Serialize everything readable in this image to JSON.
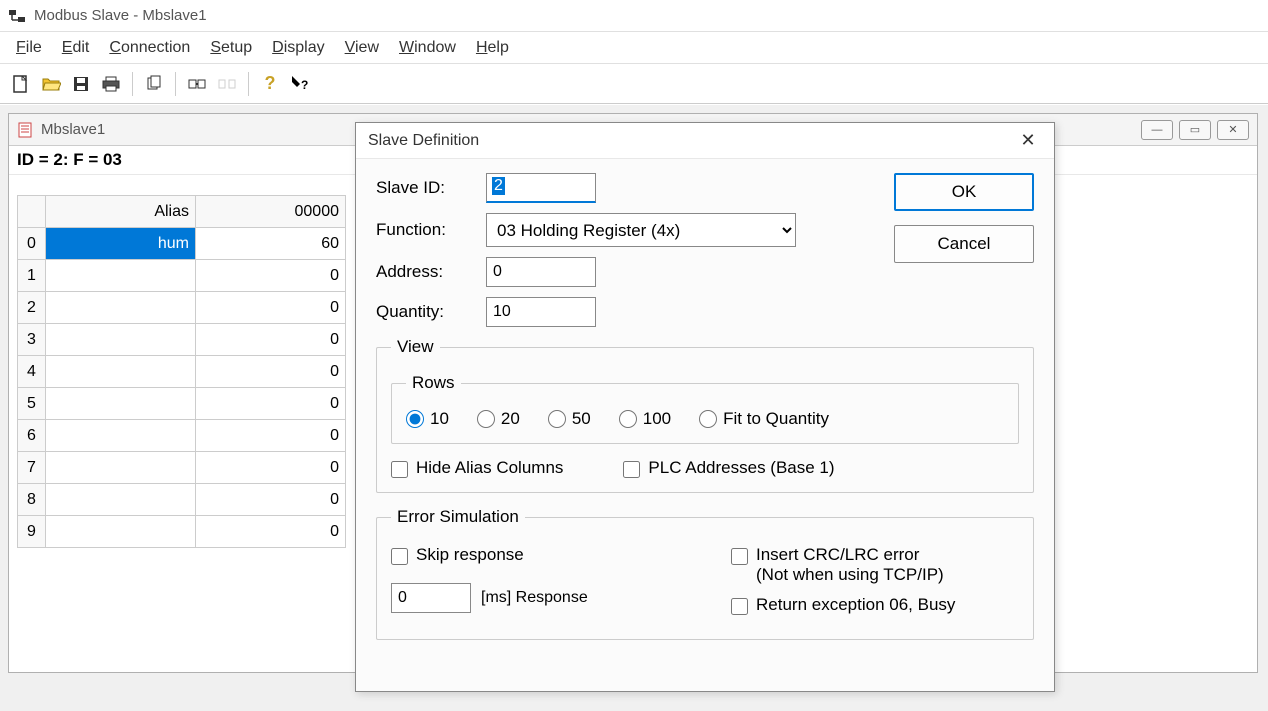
{
  "app": {
    "title": "Modbus Slave - Mbslave1"
  },
  "menu": {
    "file": "File",
    "edit": "Edit",
    "connection": "Connection",
    "setup": "Setup",
    "display": "Display",
    "view": "View",
    "window": "Window",
    "help": "Help"
  },
  "mdi": {
    "title": "Mbslave1",
    "status": "ID = 2: F = 03",
    "headers": {
      "alias": "Alias",
      "val": "00000"
    },
    "rows": [
      {
        "n": "0",
        "alias": "hum",
        "val": "60",
        "sel": true
      },
      {
        "n": "1",
        "alias": "",
        "val": "0"
      },
      {
        "n": "2",
        "alias": "",
        "val": "0"
      },
      {
        "n": "3",
        "alias": "",
        "val": "0"
      },
      {
        "n": "4",
        "alias": "",
        "val": "0"
      },
      {
        "n": "5",
        "alias": "",
        "val": "0"
      },
      {
        "n": "6",
        "alias": "",
        "val": "0"
      },
      {
        "n": "7",
        "alias": "",
        "val": "0"
      },
      {
        "n": "8",
        "alias": "",
        "val": "0"
      },
      {
        "n": "9",
        "alias": "",
        "val": "0"
      }
    ]
  },
  "dialog": {
    "title": "Slave Definition",
    "labels": {
      "slaveid": "Slave ID:",
      "function": "Function:",
      "address": "Address:",
      "quantity": "Quantity:"
    },
    "values": {
      "slaveid": "2",
      "function": "03 Holding Register (4x)",
      "address": "0",
      "quantity": "10"
    },
    "buttons": {
      "ok": "OK",
      "cancel": "Cancel"
    },
    "view": {
      "legend": "View",
      "rows_legend": "Rows",
      "radios": {
        "r10": "10",
        "r20": "20",
        "r50": "50",
        "r100": "100",
        "fit": "Fit to Quantity"
      },
      "hide_alias": "Hide Alias Columns",
      "plc_addr": "PLC Addresses (Base 1)"
    },
    "err": {
      "legend": "Error Simulation",
      "skip": "Skip response",
      "resp_val": "0",
      "resp_label": "[ms] Response",
      "crc1": "Insert CRC/LRC error",
      "crc2": "(Not when using TCP/IP)",
      "ret06": "Return exception 06, Busy"
    }
  }
}
